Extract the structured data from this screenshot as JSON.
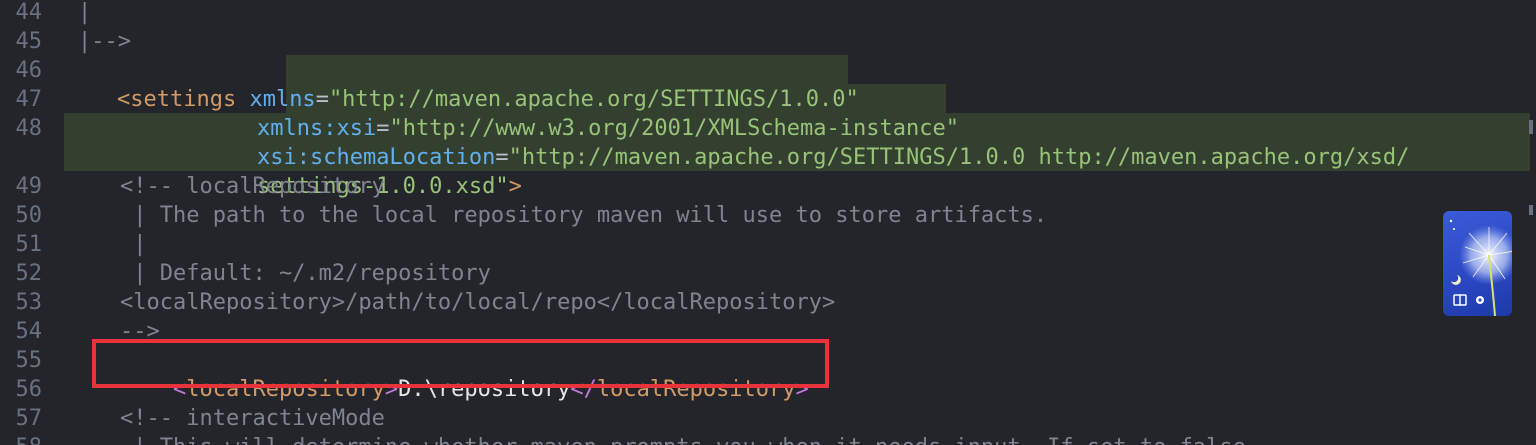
{
  "line_numbers": [
    "44",
    "45",
    "46",
    "47",
    "48",
    "49",
    "50",
    "51",
    "52",
    "53",
    "54",
    "55",
    "56",
    "57",
    "58"
  ],
  "lines": {
    "l44": "|",
    "l45": "|-->",
    "l46": {
      "open": "<settings",
      "attr": "xmlns",
      "eq": "=",
      "value": "\"http://maven.apache.org/SETTINGS/1.0.0\""
    },
    "l47": {
      "attr": "xmlns:xsi",
      "eq": "=",
      "value": "\"http://www.w3.org/2001/XMLSchema-instance\""
    },
    "l48": {
      "attr": "xsi:schemaLocation",
      "eq": "=",
      "value_part1": "\"http://maven.apache.org/SETTINGS/1.0.0 http://maven.apache.org/xsd/",
      "value_part2": "settings-1.0.0.xsd\"",
      "close": ">"
    },
    "l49": "<!-- localRepository",
    "l50": " | The path to the local repository maven will use to store artifacts.",
    "l51": " |",
    "l52": " | Default: ~/.m2/repository",
    "l53": "<localRepository>/path/to/local/repo</localRepository>",
    "l54": "-->",
    "l55": {
      "open_lt": "<",
      "open_name": "localRepository",
      "open_gt": ">",
      "text": "D:\\repository",
      "close_lt": "</",
      "close_name": "localRepository",
      "close_gt": ">"
    },
    "l57": "<!-- interactiveMode",
    "l58": " | This will determine whether maven prompts you when it needs input. If set to false,"
  },
  "colors": {
    "background": "#23252b",
    "highlight_box": "#e8333a",
    "string": "#98c379",
    "tag": "#d19a66",
    "attribute": "#61afef",
    "comment": "#7f848e",
    "bracket": "#c678dd"
  },
  "widget": {
    "icons": [
      "dandelion-image",
      "moon-icon",
      "book-icon",
      "gear-icon"
    ]
  }
}
